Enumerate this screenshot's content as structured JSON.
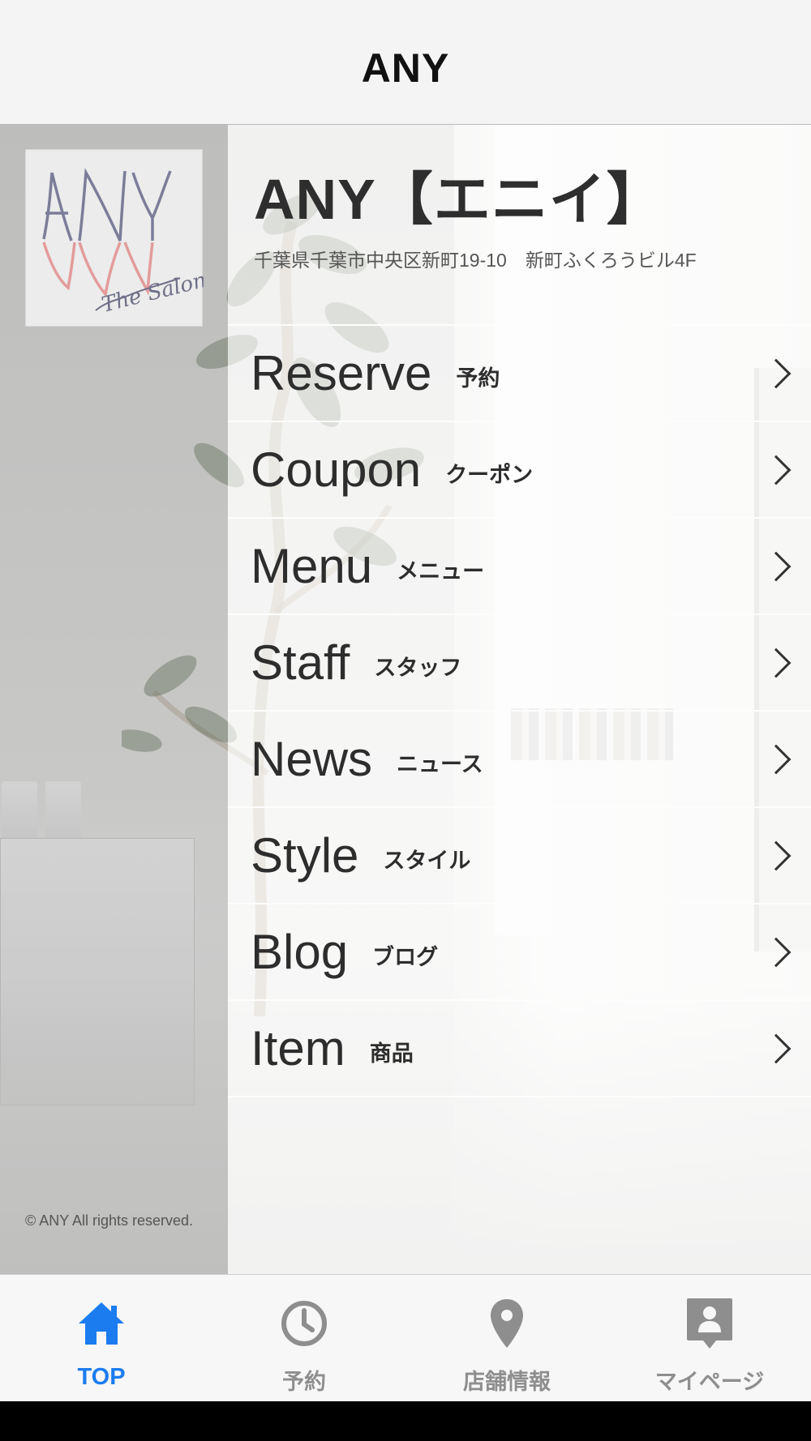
{
  "navbar": {
    "title": "ANY"
  },
  "shop": {
    "name": "ANY【エニイ】",
    "address": "千葉県千葉市中央区新町19-10　新町ふくろうビル4F",
    "logo_text": "ANY The Salon"
  },
  "menu": {
    "items": [
      {
        "en": "Reserve",
        "ja": "予約"
      },
      {
        "en": "Coupon",
        "ja": "クーポン"
      },
      {
        "en": "Menu",
        "ja": "メニュー"
      },
      {
        "en": "Staff",
        "ja": "スタッフ"
      },
      {
        "en": "News",
        "ja": "ニュース"
      },
      {
        "en": "Style",
        "ja": "スタイル"
      },
      {
        "en": "Blog",
        "ja": "ブログ"
      },
      {
        "en": "Item",
        "ja": "商品"
      }
    ]
  },
  "footer": {
    "copyright": "© ANY All rights reserved."
  },
  "tabbar": {
    "tabs": [
      {
        "label": "TOP",
        "icon": "home-icon",
        "active": true
      },
      {
        "label": "予約",
        "icon": "clock-icon",
        "active": false
      },
      {
        "label": "店舗情報",
        "icon": "map-pin-icon",
        "active": false
      },
      {
        "label": "マイページ",
        "icon": "profile-icon",
        "active": false
      }
    ],
    "active_color": "#1b7cf0",
    "inactive_color": "#8e8e8e"
  }
}
